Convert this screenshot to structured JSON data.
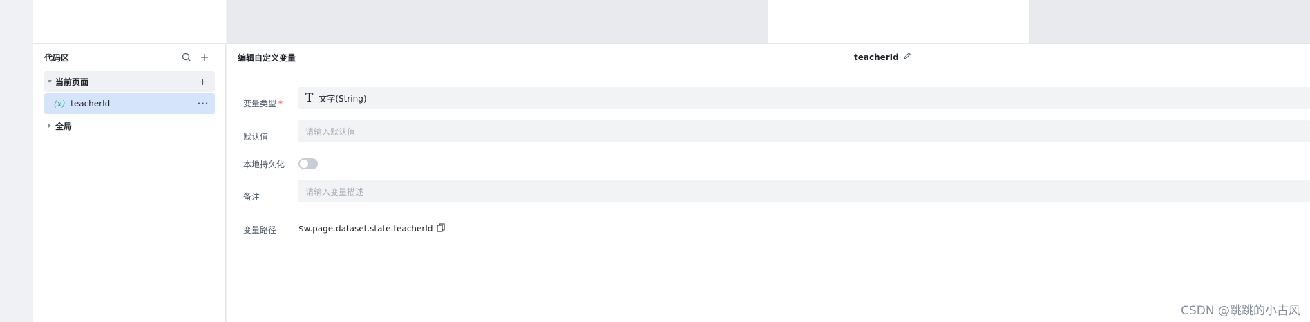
{
  "sidebar": {
    "title": "代码区",
    "groups": [
      {
        "label": "当前页面",
        "expanded": true,
        "items": [
          {
            "badge": "(x)",
            "label": "teacherId"
          }
        ]
      },
      {
        "label": "全局",
        "expanded": false
      }
    ]
  },
  "main": {
    "title": "编辑自定义变量",
    "variable_name": "teacherId",
    "form": {
      "type_label": "变量类型",
      "type_required_mark": "*",
      "type_value": "文字(String)",
      "type_icon": "T",
      "default_label": "默认值",
      "default_placeholder": "请输入默认值",
      "persist_label": "本地持久化",
      "persist_on": false,
      "note_label": "备注",
      "note_placeholder": "请输入变量描述",
      "path_label": "变量路径",
      "path_value": "$w.page.dataset.state.teacherId"
    }
  },
  "watermark": "CSDN @跳跳的小古风",
  "colors": {
    "accent_green": "#1fa67a",
    "selected_bg": "#d6e4fb",
    "required": "#f53f3f"
  }
}
